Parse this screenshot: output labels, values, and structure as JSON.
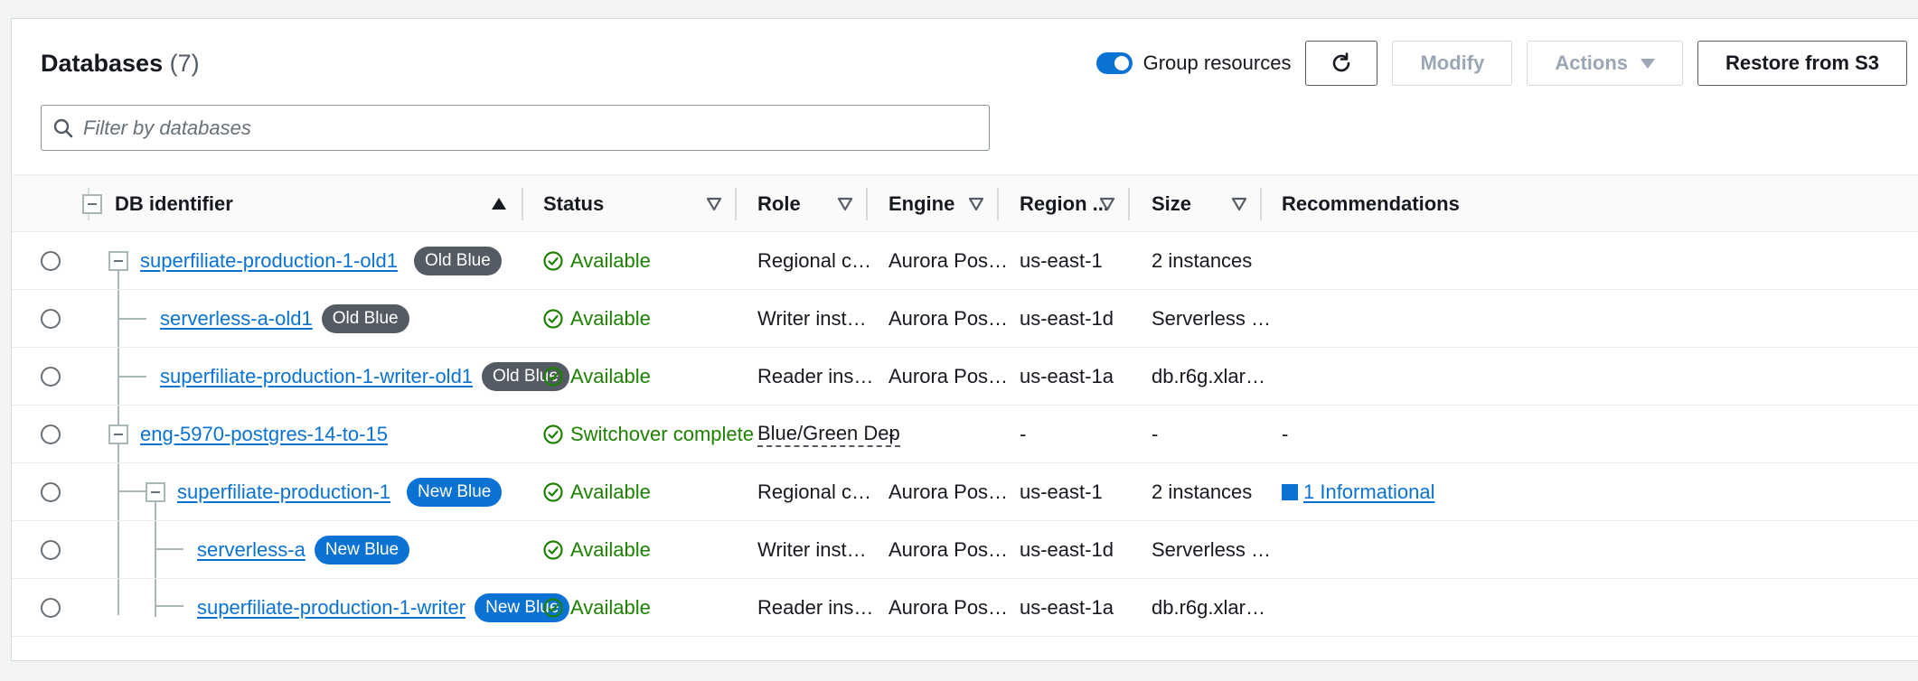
{
  "header": {
    "title": "Databases",
    "count": "(7)",
    "group_resources_label": "Group resources",
    "group_resources_on": true,
    "modify_label": "Modify",
    "actions_label": "Actions",
    "restore_label": "Restore from S3",
    "search_placeholder": "Filter by databases"
  },
  "columns": {
    "identifier": "DB identifier",
    "status": "Status",
    "role": "Role",
    "engine": "Engine",
    "region": "Region ...",
    "size": "Size",
    "recommendations": "Recommendations"
  },
  "rows": [
    {
      "id": "superfiliate-production-1-old1",
      "badge": "Old Blue",
      "status": "Available",
      "role": "Regional c…",
      "engine": "Aurora Pos…",
      "region": "us-east-1",
      "size": "2 instances",
      "rec": ""
    },
    {
      "id": "serverless-a-old1",
      "badge": "Old Blue",
      "status": "Available",
      "role": "Writer inst…",
      "engine": "Aurora Pos…",
      "region": "us-east-1d",
      "size": "Serverless …",
      "rec": ""
    },
    {
      "id": "superfiliate-production-1-writer-old1",
      "badge": "Old Blue",
      "status": "Available",
      "role": "Reader ins…",
      "engine": "Aurora Pos…",
      "region": "us-east-1a",
      "size": "db.r6g.xlar…",
      "rec": ""
    },
    {
      "id": "eng-5970-postgres-14-to-15",
      "badge": "",
      "status": "Switchover complete",
      "role": "Blue/Green Dep",
      "engine": "-",
      "region": "-",
      "size": "-",
      "rec": "-"
    },
    {
      "id": "superfiliate-production-1",
      "badge": "New Blue",
      "status": "Available",
      "role": "Regional c…",
      "engine": "Aurora Pos…",
      "region": "us-east-1",
      "size": "2 instances",
      "rec": "1 Informational"
    },
    {
      "id": "serverless-a",
      "badge": "New Blue",
      "status": "Available",
      "role": "Writer inst…",
      "engine": "Aurora Pos…",
      "region": "us-east-1d",
      "size": "Serverless …",
      "rec": ""
    },
    {
      "id": "superfiliate-production-1-writer",
      "badge": "New Blue",
      "status": "Available",
      "role": "Reader ins…",
      "engine": "Aurora Pos…",
      "region": "us-east-1a",
      "size": "db.r6g.xlar…",
      "rec": ""
    }
  ],
  "colors": {
    "link": "#0972d3",
    "success": "#1d8102",
    "old_badge": "#545b64",
    "new_badge": "#0972d3"
  }
}
